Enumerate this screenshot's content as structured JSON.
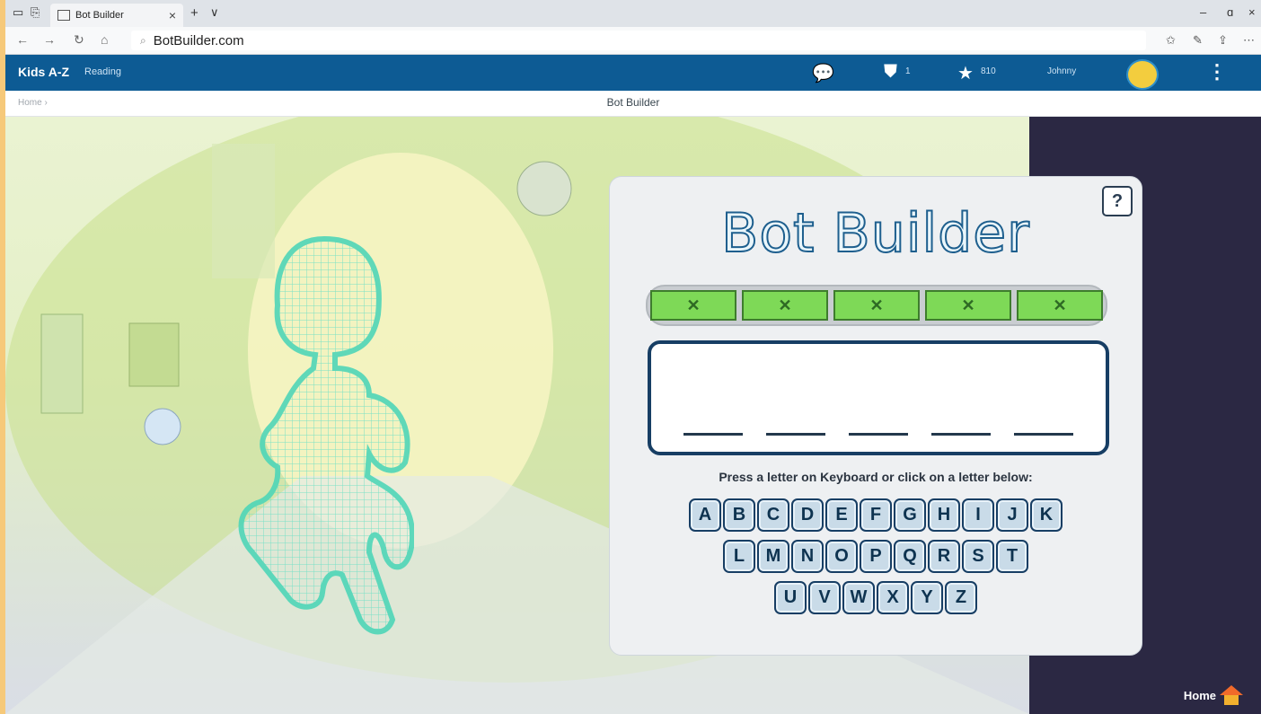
{
  "browser": {
    "tab_title": "Bot Builder",
    "tab_close": "×",
    "new_tab": "+",
    "tab_menu": "∨",
    "url": "BotBuilder.com",
    "window": {
      "minimize": "–",
      "maximize": "ɑ",
      "close": "×"
    }
  },
  "site": {
    "logo": "Kids A-Z",
    "menu": "Reading",
    "shield_count": "1",
    "star_count": "810",
    "username": "Johnny"
  },
  "subheader": {
    "breadcrumb": "Home ›",
    "page_title": "Bot Builder"
  },
  "game": {
    "title": "Bot Builder",
    "help": "?",
    "progress": [
      "✕",
      "✕",
      "✕",
      "✕",
      "✕"
    ],
    "blank_count": 5,
    "instruction": "Press a letter on Keyboard or click on a letter below:",
    "keyboard_rows": [
      [
        "A",
        "B",
        "C",
        "D",
        "E",
        "F",
        "G",
        "H",
        "I",
        "J",
        "K"
      ],
      [
        "L",
        "M",
        "N",
        "O",
        "P",
        "Q",
        "R",
        "S",
        "T"
      ],
      [
        "U",
        "V",
        "W",
        "X",
        "Y",
        "Z"
      ]
    ],
    "home_label": "Home"
  },
  "colors": {
    "header_blue": "#0d5b94",
    "progress_green": "#7ed957",
    "key_fill": "#c9dbe8",
    "robot_outline": "#4fd6b8"
  }
}
